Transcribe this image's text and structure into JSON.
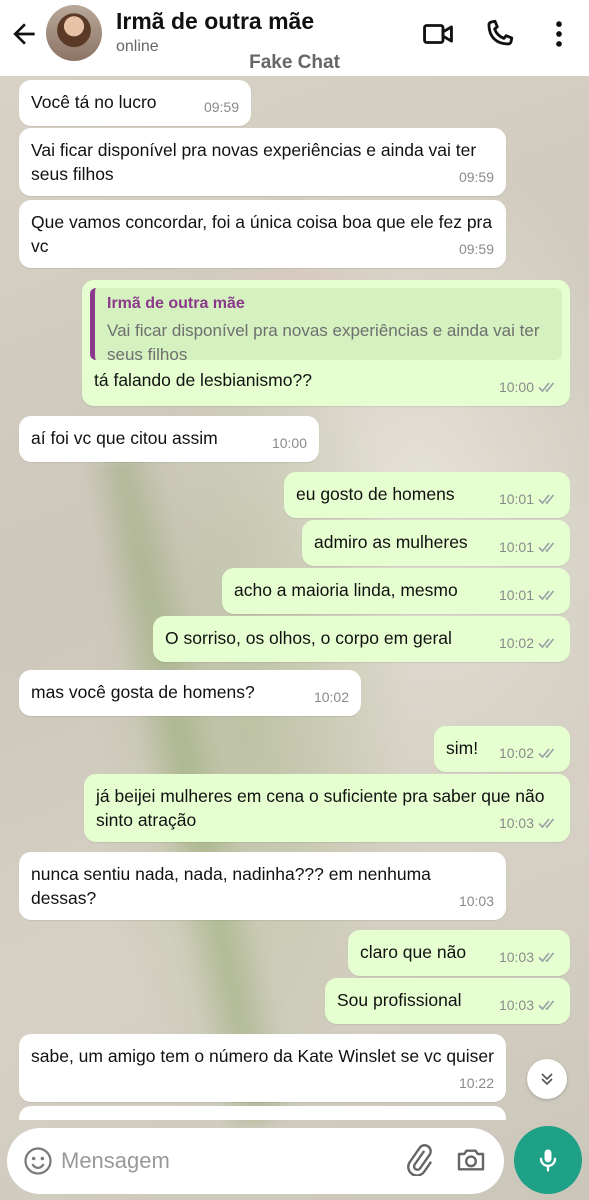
{
  "header": {
    "contact_name": "Irmã de outra mãe",
    "status": "online",
    "caption": "Fake Chat"
  },
  "icons": {
    "back": "arrow-left-icon",
    "video": "video-camera-icon",
    "call": "phone-icon",
    "menu": "more-vertical-icon",
    "emoji": "smiley-icon",
    "attach": "paperclip-icon",
    "camera": "camera-icon",
    "mic": "microphone-icon",
    "scroll": "double-chevron-down-icon"
  },
  "colors": {
    "outgoing_bubble": "#e6ffd0",
    "incoming_bubble": "#ffffff",
    "mic_button": "#1fa187",
    "quote_accent": "#8b3a8b",
    "read_ticks": "#9aa0a6"
  },
  "messages": [
    {
      "dir": "in",
      "text": "Você tá no lucro",
      "time": "09:59"
    },
    {
      "dir": "in",
      "text": "Vai ficar disponível pra novas experiências e ainda vai ter seus filhos",
      "time": "09:59"
    },
    {
      "dir": "in",
      "text": "Que vamos concordar, foi a única coisa boa que ele fez pra vc",
      "time": "09:59"
    },
    {
      "dir": "out",
      "text": "tá falando de lesbianismo??",
      "time": "10:00",
      "quote": {
        "author": "Irmã de outra mãe",
        "text": "Vai ficar disponível pra novas experiências e ainda vai ter seus filhos"
      }
    },
    {
      "dir": "in",
      "text": "aí foi vc que citou assim",
      "time": "10:00"
    },
    {
      "dir": "out",
      "text": "eu gosto de homens",
      "time": "10:01"
    },
    {
      "dir": "out",
      "text": "admiro as mulheres",
      "time": "10:01"
    },
    {
      "dir": "out",
      "text": "acho a maioria linda, mesmo",
      "time": "10:01"
    },
    {
      "dir": "out",
      "text": "O sorriso, os olhos, o corpo em geral",
      "time": "10:02"
    },
    {
      "dir": "in",
      "text": "mas você gosta de homens?",
      "time": "10:02"
    },
    {
      "dir": "out",
      "text": "sim!",
      "time": "10:02"
    },
    {
      "dir": "out",
      "text": "já beijei mulheres em cena o suficiente pra saber que não sinto atração",
      "time": "10:03"
    },
    {
      "dir": "in",
      "text": "nunca sentiu nada, nada, nadinha??? em nenhuma dessas?",
      "time": "10:03"
    },
    {
      "dir": "out",
      "text": "claro que não",
      "time": "10:03"
    },
    {
      "dir": "out",
      "text": "Sou profissional",
      "time": "10:03"
    },
    {
      "dir": "in",
      "text": "sabe, um amigo tem o número da Kate Winslet se vc quiser",
      "time": "10:22"
    }
  ],
  "composer": {
    "placeholder": "Mensagem"
  }
}
